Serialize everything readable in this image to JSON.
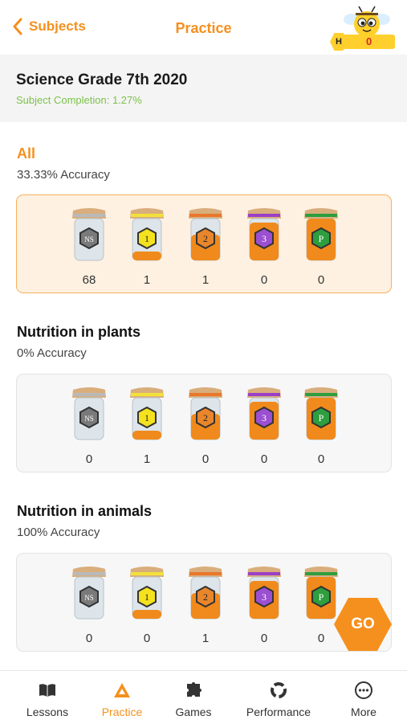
{
  "header": {
    "back_label": "Subjects",
    "title": "Practice",
    "honey_badge": "H",
    "honey_count": "0"
  },
  "subject": {
    "name": "Science Grade 7th 2020",
    "completion": "Subject Completion: 1.27%"
  },
  "sections": [
    {
      "title": "All",
      "accuracy": "33.33% Accuracy",
      "counts": [
        "68",
        "1",
        "1",
        "0",
        "0"
      ]
    },
    {
      "title": "Nutrition in plants",
      "accuracy": "0% Accuracy",
      "counts": [
        "0",
        "1",
        "0",
        "0",
        "0"
      ]
    },
    {
      "title": "Nutrition in animals",
      "accuracy": "100% Accuracy",
      "counts": [
        "0",
        "0",
        "1",
        "0",
        "0"
      ]
    }
  ],
  "jar_labels": [
    "NS",
    "1",
    "2",
    "3",
    "P"
  ],
  "colors": {
    "accent": "#f5901e",
    "completion": "#7cc24a",
    "highlight_card": "#fff1e2"
  },
  "go_label": "GO",
  "nav": [
    {
      "label": "Lessons",
      "icon": "book-icon"
    },
    {
      "label": "Practice",
      "icon": "triangle-practice-icon"
    },
    {
      "label": "Games",
      "icon": "puzzle-icon"
    },
    {
      "label": "Performance",
      "icon": "performance-ring-icon"
    },
    {
      "label": "More",
      "icon": "more-dots-icon"
    }
  ]
}
